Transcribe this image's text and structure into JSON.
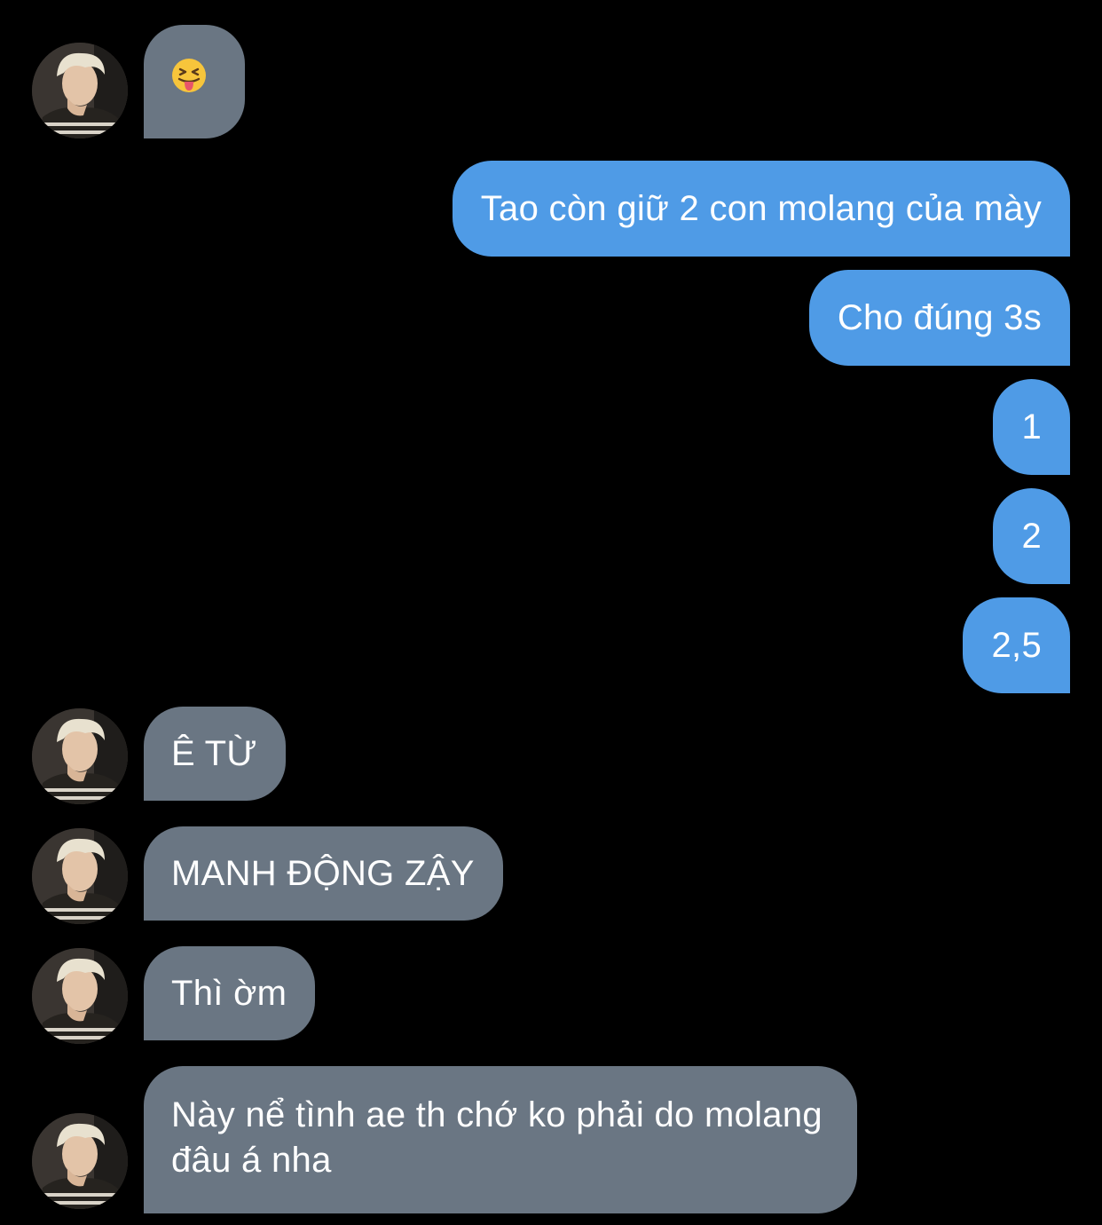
{
  "chat": {
    "emoji_icon": "squinting-face-with-tongue-icon",
    "avatar_icon": "contact-avatar-icon",
    "colors": {
      "background": "#000000",
      "incoming_bubble": "#6a7683",
      "outgoing_bubble": "#4f9be6",
      "text": "#ffffff"
    },
    "messages": [
      {
        "from": "contact",
        "type": "emoji",
        "text": ""
      },
      {
        "from": "me",
        "text": "Tao còn giữ 2 con molang của mày"
      },
      {
        "from": "me",
        "text": "Cho đúng 3s"
      },
      {
        "from": "me",
        "text": "1"
      },
      {
        "from": "me",
        "text": "2"
      },
      {
        "from": "me",
        "text": "2,5"
      },
      {
        "from": "contact",
        "text": "Ê TỪ"
      },
      {
        "from": "contact",
        "text": "MANH ĐỘNG ZẬY"
      },
      {
        "from": "contact",
        "text": "Thì ờm"
      },
      {
        "from": "contact",
        "text": "Này nể tình ae th chớ ko phải do molang đâu á nha"
      }
    ]
  }
}
